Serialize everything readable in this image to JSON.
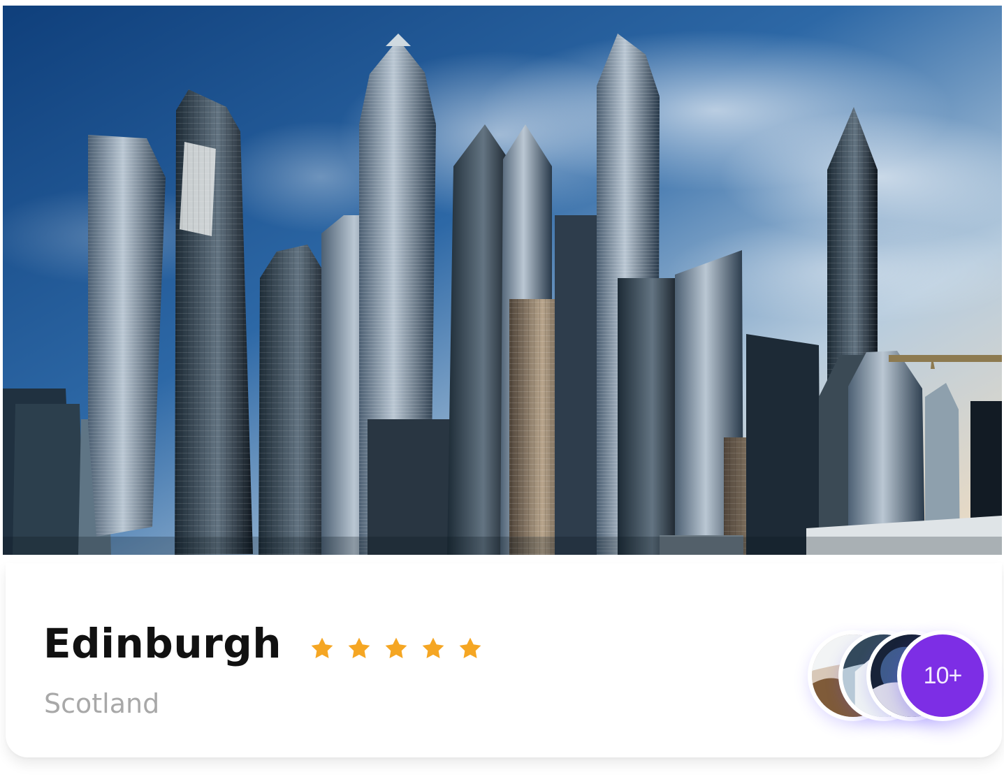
{
  "card": {
    "title": "Edinburgh",
    "subtitle": "Scotland",
    "rating": 5,
    "stars": [
      "star-icon",
      "star-icon",
      "star-icon",
      "star-icon",
      "star-icon"
    ],
    "more_count_label": "10+"
  },
  "colors": {
    "title": "#111111",
    "subtitle": "#a8a8a8",
    "star": "#f5a623",
    "more_badge": "#7d2ee5"
  },
  "images": {
    "hero": "city-skyline-photo",
    "avatars": [
      "avatar-photo",
      "avatar-photo",
      "avatar-photo"
    ]
  }
}
